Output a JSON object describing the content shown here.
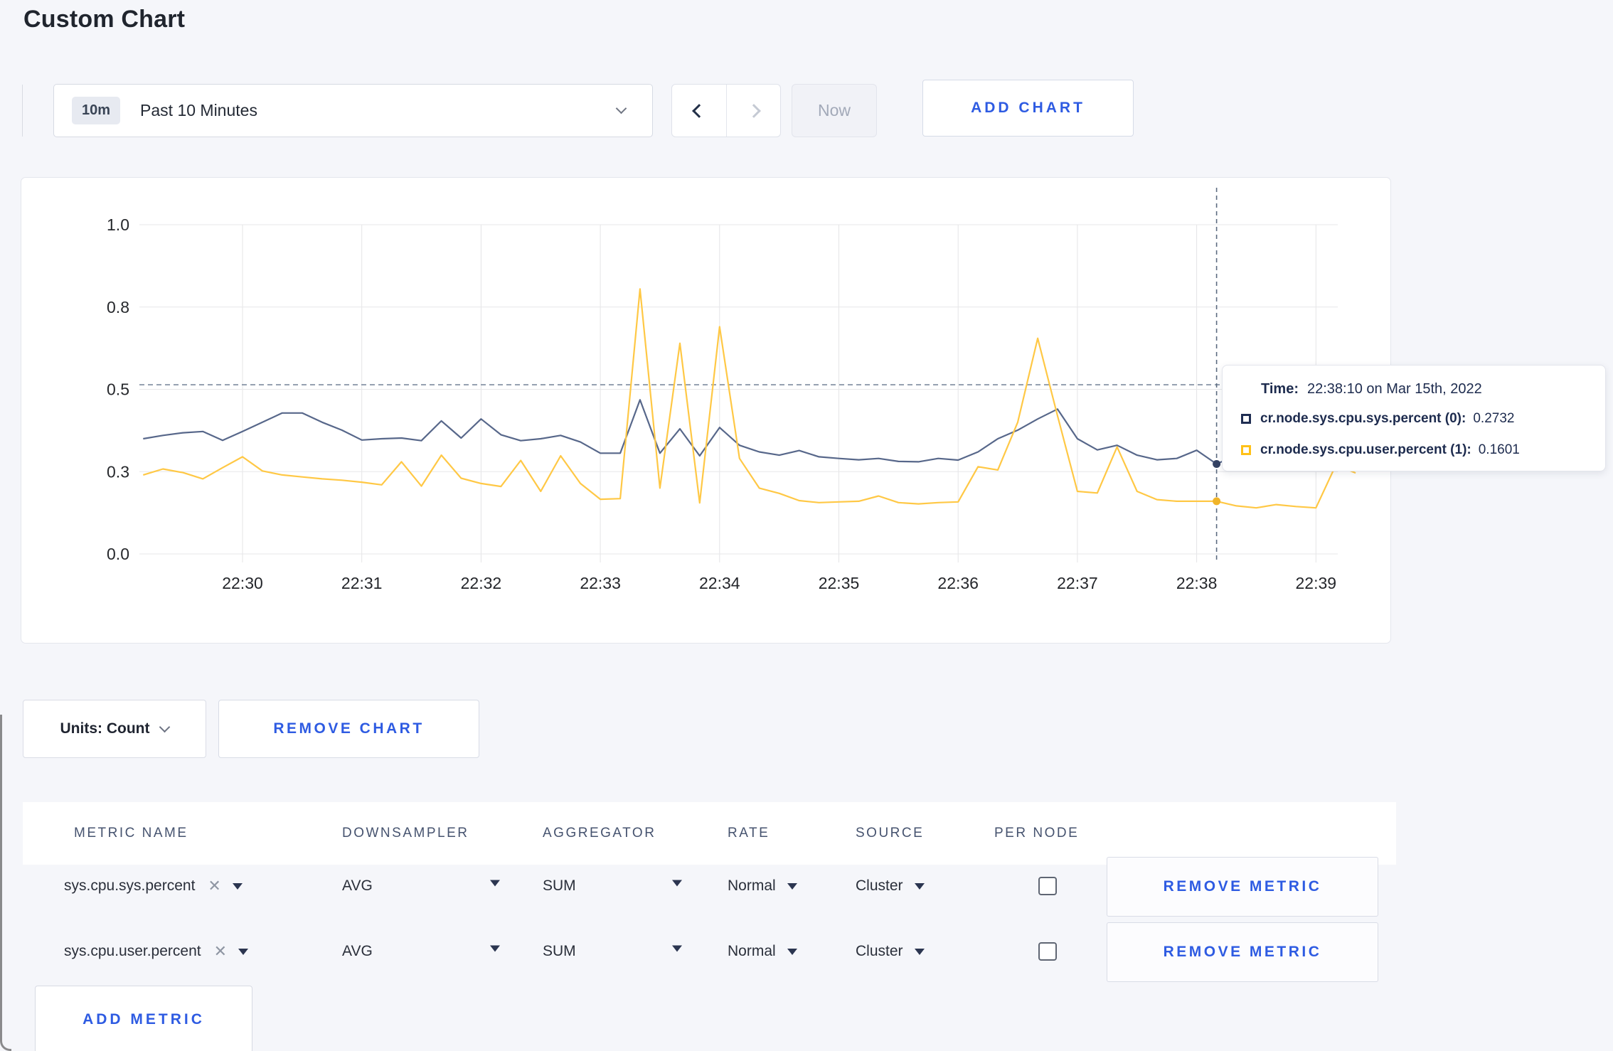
{
  "page": {
    "title": "Custom Chart",
    "background": "#f5f6fa",
    "accent_blue": "#2e5be2"
  },
  "toolbar": {
    "time_range": {
      "badge": "10m",
      "label": "Past 10 Minutes"
    },
    "now_label": "Now",
    "add_chart_label": "ADD CHART"
  },
  "tooltip": {
    "time_label": "Time:",
    "time_value": "22:38:10 on Mar 15th, 2022",
    "entries": [
      {
        "name": "cr.node.sys.cpu.sys.percent (0):",
        "value": "0.2732",
        "color": "#1f2d52"
      },
      {
        "name": "cr.node.sys.cpu.user.percent (1):",
        "value": "0.1601",
        "color": "#ffc117"
      }
    ]
  },
  "units": {
    "label": "Units: Count"
  },
  "remove_chart_label": "REMOVE CHART",
  "add_metric_label": "ADD METRIC",
  "table": {
    "headers": [
      "METRIC NAME",
      "DOWNSAMPLER",
      "AGGREGATOR",
      "RATE",
      "SOURCE",
      "PER NODE"
    ],
    "remove_metric_label": "REMOVE METRIC",
    "rows": [
      {
        "metric": "sys.cpu.sys.percent",
        "downsampler": "AVG",
        "aggregator": "SUM",
        "rate": "Normal",
        "source": "Cluster",
        "per_node_checked": false
      },
      {
        "metric": "sys.cpu.user.percent",
        "downsampler": "AVG",
        "aggregator": "SUM",
        "rate": "Normal",
        "source": "Cluster",
        "per_node_checked": false
      }
    ]
  },
  "chart_data": {
    "type": "line",
    "title": "",
    "xlabel": "",
    "ylabel": "",
    "x_axis": {
      "ticks": [
        "22:30",
        "22:31",
        "22:32",
        "22:33",
        "22:34",
        "22:35",
        "22:36",
        "22:37",
        "22:38",
        "22:39"
      ]
    },
    "y_axis": {
      "range": [
        0,
        1
      ],
      "ticks": [
        {
          "v": 0,
          "label": "0.0"
        },
        {
          "v": 0.25,
          "label": "0.3"
        },
        {
          "v": 0.5,
          "label": "0.5"
        },
        {
          "v": 0.75,
          "label": "0.8"
        },
        {
          "v": 1,
          "label": "1.0"
        }
      ]
    },
    "grid": true,
    "legend_position": "tooltip",
    "crosshair": {
      "t": 8.167,
      "time": "22:38:10 on Mar 15th, 2022",
      "guideline_v": 0.514,
      "values": [
        0.2732,
        0.1601
      ]
    },
    "series": [
      {
        "name": "cr.node.sys.cpu.sys.percent",
        "color": "#57678a",
        "dot_color": "#344263",
        "points": [
          [
            -0.833,
            0.35
          ],
          [
            -0.667,
            0.36
          ],
          [
            -0.5,
            0.368
          ],
          [
            -0.333,
            0.372
          ],
          [
            -0.167,
            0.345
          ],
          [
            0,
            0.372
          ],
          [
            0.167,
            0.4
          ],
          [
            0.333,
            0.428
          ],
          [
            0.5,
            0.428
          ],
          [
            0.667,
            0.4
          ],
          [
            0.833,
            0.376
          ],
          [
            1,
            0.346
          ],
          [
            1.167,
            0.35
          ],
          [
            1.333,
            0.352
          ],
          [
            1.5,
            0.344
          ],
          [
            1.667,
            0.404
          ],
          [
            1.833,
            0.352
          ],
          [
            2,
            0.41
          ],
          [
            2.167,
            0.362
          ],
          [
            2.333,
            0.344
          ],
          [
            2.5,
            0.35
          ],
          [
            2.667,
            0.36
          ],
          [
            2.833,
            0.34
          ],
          [
            3,
            0.306
          ],
          [
            3.167,
            0.306
          ],
          [
            3.333,
            0.468
          ],
          [
            3.5,
            0.306
          ],
          [
            3.667,
            0.38
          ],
          [
            3.833,
            0.298
          ],
          [
            4,
            0.384
          ],
          [
            4.167,
            0.33
          ],
          [
            4.333,
            0.31
          ],
          [
            4.5,
            0.3
          ],
          [
            4.667,
            0.314
          ],
          [
            4.833,
            0.295
          ],
          [
            5,
            0.29
          ],
          [
            5.167,
            0.286
          ],
          [
            5.333,
            0.29
          ],
          [
            5.5,
            0.281
          ],
          [
            5.667,
            0.28
          ],
          [
            5.833,
            0.29
          ],
          [
            6,
            0.285
          ],
          [
            6.167,
            0.31
          ],
          [
            6.333,
            0.35
          ],
          [
            6.5,
            0.376
          ],
          [
            6.667,
            0.41
          ],
          [
            6.833,
            0.44
          ],
          [
            7,
            0.35
          ],
          [
            7.167,
            0.316
          ],
          [
            7.333,
            0.33
          ],
          [
            7.5,
            0.3
          ],
          [
            7.667,
            0.286
          ],
          [
            7.833,
            0.29
          ],
          [
            8,
            0.315
          ],
          [
            8.167,
            0.2732
          ],
          [
            8.333,
            0.3
          ],
          [
            8.5,
            0.312
          ],
          [
            8.667,
            0.296
          ],
          [
            8.833,
            0.3
          ],
          [
            9,
            0.298
          ],
          [
            9.167,
            0.306
          ],
          [
            9.333,
            0.3
          ]
        ]
      },
      {
        "name": "cr.node.sys.cpu.user.percent",
        "color": "#ffc845",
        "dot_color": "#f0b429",
        "points": [
          [
            -0.833,
            0.24
          ],
          [
            -0.667,
            0.258
          ],
          [
            -0.5,
            0.247
          ],
          [
            -0.333,
            0.228
          ],
          [
            -0.167,
            0.262
          ],
          [
            0,
            0.295
          ],
          [
            0.167,
            0.252
          ],
          [
            0.333,
            0.24
          ],
          [
            0.5,
            0.234
          ],
          [
            0.667,
            0.228
          ],
          [
            0.833,
            0.224
          ],
          [
            1,
            0.218
          ],
          [
            1.167,
            0.21
          ],
          [
            1.333,
            0.28
          ],
          [
            1.5,
            0.206
          ],
          [
            1.667,
            0.3
          ],
          [
            1.833,
            0.23
          ],
          [
            2,
            0.214
          ],
          [
            2.167,
            0.205
          ],
          [
            2.333,
            0.284
          ],
          [
            2.5,
            0.19
          ],
          [
            2.667,
            0.298
          ],
          [
            2.833,
            0.214
          ],
          [
            3,
            0.166
          ],
          [
            3.167,
            0.168
          ],
          [
            3.333,
            0.805
          ],
          [
            3.5,
            0.2
          ],
          [
            3.667,
            0.64
          ],
          [
            3.833,
            0.155
          ],
          [
            4,
            0.69
          ],
          [
            4.167,
            0.29
          ],
          [
            4.333,
            0.2
          ],
          [
            4.5,
            0.184
          ],
          [
            4.667,
            0.162
          ],
          [
            4.833,
            0.156
          ],
          [
            5,
            0.158
          ],
          [
            5.167,
            0.16
          ],
          [
            5.333,
            0.176
          ],
          [
            5.5,
            0.156
          ],
          [
            5.667,
            0.152
          ],
          [
            5.833,
            0.156
          ],
          [
            6,
            0.158
          ],
          [
            6.167,
            0.265
          ],
          [
            6.333,
            0.255
          ],
          [
            6.5,
            0.4
          ],
          [
            6.667,
            0.655
          ],
          [
            6.833,
            0.42
          ],
          [
            7,
            0.19
          ],
          [
            7.167,
            0.185
          ],
          [
            7.333,
            0.325
          ],
          [
            7.5,
            0.19
          ],
          [
            7.667,
            0.165
          ],
          [
            7.833,
            0.16
          ],
          [
            8,
            0.16
          ],
          [
            8.167,
            0.1601
          ],
          [
            8.333,
            0.146
          ],
          [
            8.5,
            0.14
          ],
          [
            8.667,
            0.15
          ],
          [
            8.833,
            0.144
          ],
          [
            9,
            0.14
          ],
          [
            9.167,
            0.27
          ],
          [
            9.333,
            0.246
          ]
        ]
      }
    ]
  }
}
